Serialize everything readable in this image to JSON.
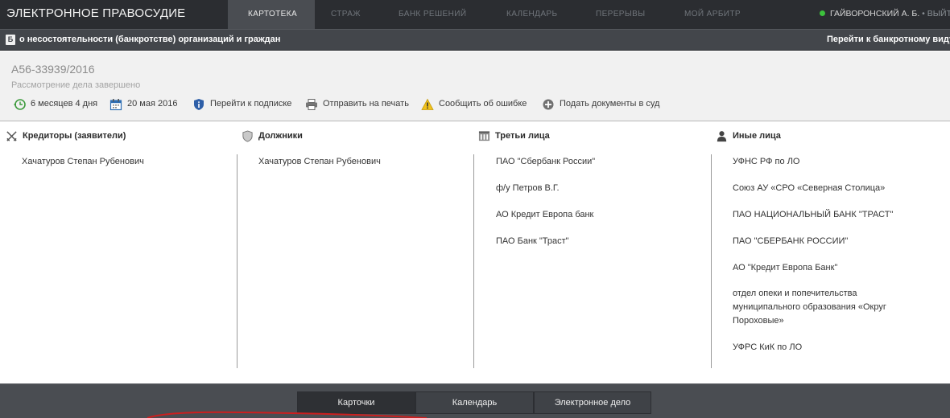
{
  "header": {
    "brand": "ЭЛЕКТРОННОЕ ПРАВОСУДИЕ",
    "tabs": [
      {
        "label": "КАРТОТЕКА",
        "active": true
      },
      {
        "label": "СТРАЖ",
        "active": false
      },
      {
        "label": "БАНК РЕШЕНИЙ",
        "active": false
      },
      {
        "label": "КАЛЕНДАРЬ",
        "active": false
      },
      {
        "label": "ПЕРЕРЫВЫ",
        "active": false
      },
      {
        "label": "МОЙ АРБИТР",
        "active": false
      }
    ],
    "user": "ГАЙВОРОНСКИЙ А. Б.",
    "logout": "ВЫЙТИ"
  },
  "subheader": {
    "icon_letter": "Б",
    "title": "о несостоятельности (банкротстве) организаций и граждан",
    "link": "Перейти к банкротному виду"
  },
  "case": {
    "number": "А56-33939/2016",
    "status": "Рассмотрение дела завершено",
    "actions": [
      {
        "icon": "clock-back-icon",
        "label": "6 месяцев 4 дня"
      },
      {
        "icon": "calendar-icon",
        "label": "20 мая 2016"
      },
      {
        "icon": "shield-info-icon",
        "label": "Перейти к подписке"
      },
      {
        "icon": "printer-icon",
        "label": "Отправить на печать"
      },
      {
        "icon": "warning-icon",
        "label": "Сообщить об ошибке"
      },
      {
        "icon": "plus-circle-icon",
        "label": "Подать документы в суд"
      }
    ]
  },
  "columns": [
    {
      "title": "Кредиторы (заявители)",
      "icon": "crossed-swords-icon",
      "items": [
        "Хачатуров Степан Рубенович"
      ]
    },
    {
      "title": "Должники",
      "icon": "shield-icon",
      "items": [
        "Хачатуров Степан Рубенович"
      ]
    },
    {
      "title": "Третьи лица",
      "icon": "building-icon",
      "items": [
        "ПАО \"Сбербанк России\"",
        "ф/у Петров В.Г.",
        "АО Кредит Европа банк",
        "ПАО Банк \"Траст\""
      ]
    },
    {
      "title": "Иные лица",
      "icon": "person-icon",
      "items": [
        "УФНС РФ по ЛО",
        "Союз АУ «СРО «Северная Столица»",
        "ПАО НАЦИОНАЛЬНЫЙ БАНК \"ТРАСТ\"",
        "ПАО \"СБЕРБАНК РОССИИ\"",
        "АО \"Кредит Европа Банк\"",
        "отдел опеки и попечительства",
        "муниципального образования «Округ",
        "Пороховые»",
        "УФРС КиК по ЛО"
      ]
    }
  ],
  "bottom_tabs": [
    {
      "label": "Карточки",
      "active": true
    },
    {
      "label": "Календарь",
      "active": false
    },
    {
      "label": "Электронное дело",
      "active": false
    }
  ],
  "colors": {
    "nav_bg": "#2b2d31",
    "subbar_bg": "#43464b",
    "bottom_bg": "#4a4d52",
    "online_dot": "#3cc13c",
    "annotation": "#cc1f1f"
  }
}
